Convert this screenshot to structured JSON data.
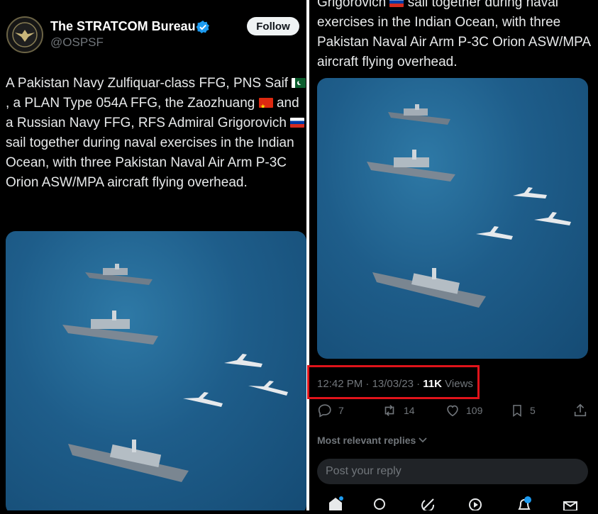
{
  "left_post": {
    "account_name": "The STRATCOM Bureau",
    "handle": "@OSPSF",
    "follow_label": "Follow",
    "text_1": "A Pakistan Navy Zulfiquar-class FFG, PNS Saif",
    "text_2": ", a PLAN Type 054A FFG, the Zaozhuang",
    "text_3": "and a Russian Navy FFG, RFS Admiral Grigorovich",
    "text_4": "sail together during naval exercises in the Indian Ocean, with three Pakistan Naval Air Arm P-3C Orion ASW/MPA aircraft flying overhead."
  },
  "right_post": {
    "top_text_1": "Grigorovich",
    "top_text_2": "sail together during naval exercises in the Indian Ocean, with three Pakistan Naval Air Arm P-3C Orion ASW/MPA aircraft flying overhead.",
    "time": "12:42 PM",
    "separator": "·",
    "date": "13/03/23",
    "views_count": "11K",
    "views_label": "Views",
    "replies_count": "7",
    "reposts_count": "14",
    "likes_count": "109",
    "bookmarks_count": "5",
    "most_relevant_label": "Most relevant replies",
    "reply_placeholder": "Post your reply"
  },
  "icons": [
    "verified-icon",
    "reply-icon",
    "repost-icon",
    "like-icon",
    "bookmark-icon",
    "share-icon",
    "chevron-down-icon",
    "home-icon",
    "search-icon",
    "grok-icon",
    "video-icon",
    "notifications-icon",
    "messages-icon"
  ],
  "colors": {
    "accent": "#1d9bf0",
    "highlight_box": "#e0131a",
    "background": "#000000",
    "muted": "#71767b"
  }
}
